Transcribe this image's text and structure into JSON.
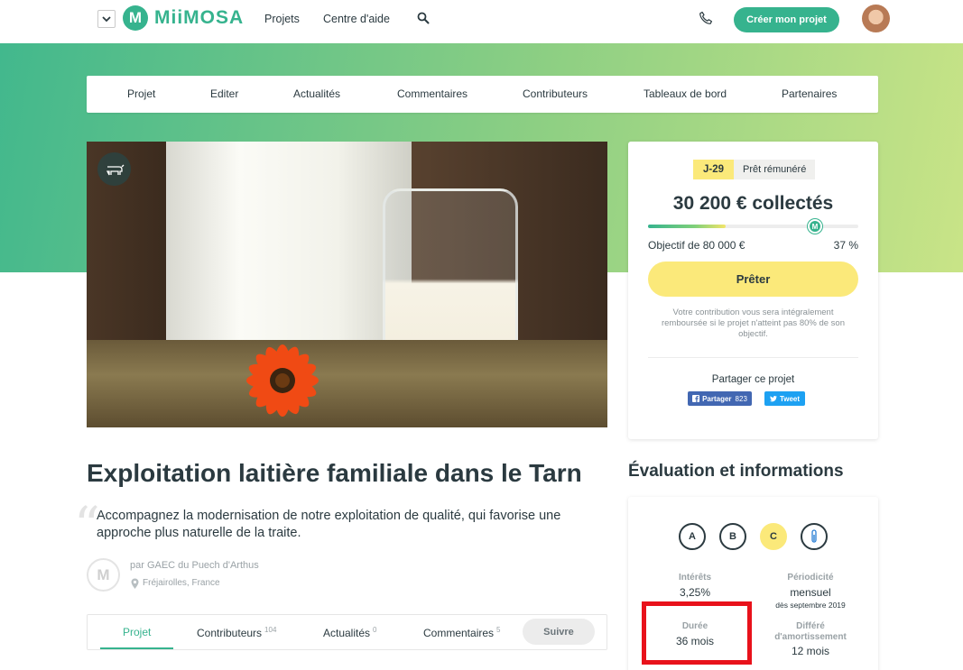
{
  "topnav": {
    "brand": "MiiMOSA",
    "logo_letter": "M",
    "links": [
      "Projets",
      "Centre d'aide"
    ],
    "create_button": "Créer mon projet"
  },
  "subnav": {
    "items": [
      "Projet",
      "Editer",
      "Actualités",
      "Commentaires",
      "Contributeurs",
      "Tableaux de bord",
      "Partenaires"
    ]
  },
  "funding": {
    "days_left": "J-29",
    "type": "Prêt rémunéré",
    "collected": "30 200 € collectés",
    "progress_fraction": 0.37,
    "goal": "Objectif de 80 000 €",
    "percent": "37 %",
    "lend_button": "Prêter",
    "note": "Votre contribution vous sera intégralement remboursée si le projet n'atteint pas 80% de son objectif.",
    "share_title": "Partager ce projet",
    "facebook_label": "Partager",
    "facebook_count": "823",
    "twitter_label": "Tweet"
  },
  "project": {
    "title": "Exploitation laitière familiale dans le Tarn",
    "description": "Accompagnez la modernisation de notre exploitation de qualité, qui favorise une approche plus naturelle de la traite.",
    "owner": "par GAEC du Puech d'Arthus",
    "location": "Fréjairolles, France"
  },
  "tabs": {
    "items": [
      {
        "label": "Projet",
        "count": ""
      },
      {
        "label": "Contributeurs",
        "count": "104"
      },
      {
        "label": "Actualités",
        "count": "0"
      },
      {
        "label": "Commentaires",
        "count": "5"
      }
    ],
    "follow_button": "Suivre"
  },
  "evaluation": {
    "heading": "Évaluation et informations",
    "grades": [
      "A",
      "B",
      "C"
    ],
    "selected_grade": "C",
    "interest_label": "Intérêts",
    "interest_value": "3,25%",
    "periodicity_label": "Périodicité",
    "periodicity_value": "mensuel",
    "periodicity_sub": "dès septembre 2019",
    "duration_label": "Durée",
    "duration_value": "36 mois",
    "deferral_label_line1": "Différé",
    "deferral_label_line2": "d'amortissement",
    "deferral_value": "12 mois"
  },
  "colors": {
    "brand_green": "#36b38e",
    "accent_yellow": "#fbe97a",
    "highlight_red": "#e8121b"
  },
  "icons": [
    "menu-toggle-icon",
    "search-icon",
    "phone-icon",
    "cow-icon",
    "location-pin-icon",
    "facebook-icon",
    "twitter-icon",
    "thermometer-icon"
  ]
}
